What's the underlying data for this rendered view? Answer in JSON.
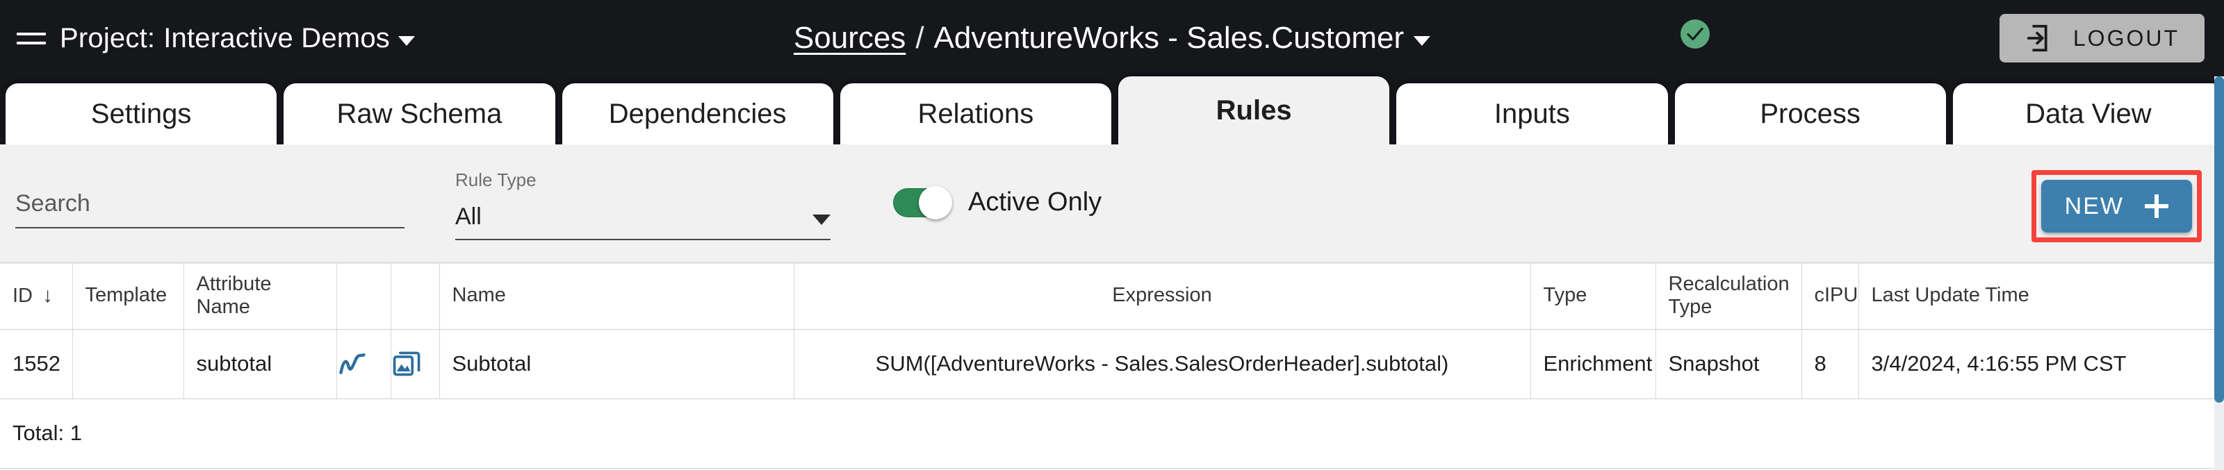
{
  "header": {
    "menu_icon": "hamburger-icon",
    "project_prefix": "Project:",
    "project_name": "Interactive Demos",
    "breadcrumb": {
      "root": "Sources",
      "separator": "/",
      "current": "AdventureWorks - Sales.Customer"
    },
    "status_icon": "check-circle-icon",
    "status_color": "#5aa97d",
    "logout_label": "LOGOUT",
    "logout_icon": "logout-icon"
  },
  "tabs": [
    {
      "label": "Settings",
      "active": false
    },
    {
      "label": "Raw Schema",
      "active": false
    },
    {
      "label": "Dependencies",
      "active": false
    },
    {
      "label": "Relations",
      "active": false
    },
    {
      "label": "Rules",
      "active": true
    },
    {
      "label": "Inputs",
      "active": false
    },
    {
      "label": "Process",
      "active": false
    },
    {
      "label": "Data View",
      "active": false
    }
  ],
  "toolbar": {
    "search_placeholder": "Search",
    "search_value": "",
    "rule_type_label": "Rule Type",
    "rule_type_value": "All",
    "rule_type_options": [
      "All"
    ],
    "active_only_label": "Active Only",
    "active_only_on": true,
    "active_toggle_color": "#2e8b57",
    "new_label": "NEW",
    "new_icon": "plus-icon",
    "new_button_color": "#3d7fad",
    "highlight_color": "#f8423c"
  },
  "table": {
    "columns": [
      {
        "key": "id",
        "label": "ID",
        "sorted": true,
        "sort_dir": "↓"
      },
      {
        "key": "template",
        "label": "Template"
      },
      {
        "key": "attribute_name",
        "label": "Attribute Name"
      },
      {
        "key": "trend",
        "label": ""
      },
      {
        "key": "preview",
        "label": ""
      },
      {
        "key": "name",
        "label": "Name"
      },
      {
        "key": "expression",
        "label": "Expression"
      },
      {
        "key": "type",
        "label": "Type"
      },
      {
        "key": "recalculation_type",
        "label": "Recalculation Type"
      },
      {
        "key": "cipu",
        "label": "cIPU"
      },
      {
        "key": "last_update_time",
        "label": "Last Update Time"
      }
    ],
    "rows": [
      {
        "id": "1552",
        "template": "",
        "attribute_name": "subtotal",
        "trend_icon": "trending-line-icon",
        "preview_icon": "image-library-icon",
        "name": "Subtotal",
        "expression": "SUM([AdventureWorks - Sales.SalesOrderHeader].subtotal)",
        "type": "Enrichment",
        "recalculation_type": "Snapshot",
        "cipu": "8",
        "last_update_time": "3/4/2024, 4:16:55 PM CST"
      }
    ],
    "footer_total": "Total: 1"
  },
  "scrollbar": {
    "color": "#3d7fad"
  }
}
